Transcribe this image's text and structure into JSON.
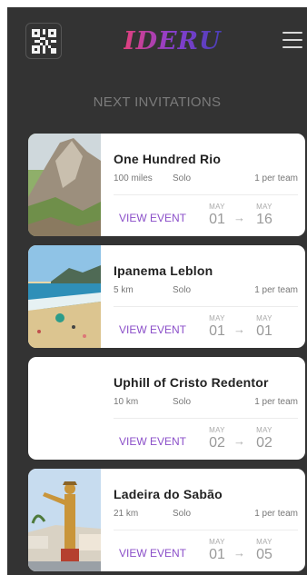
{
  "header": {
    "logo_text": "IDERU",
    "qr_icon": "qr-code-icon",
    "menu_icon": "hamburger-menu-icon"
  },
  "section": {
    "title": "NEXT INVITATIONS"
  },
  "cards": [
    {
      "title": "One Hundred Rio",
      "distance": "100 miles",
      "mode": "Solo",
      "team": "1 per team",
      "view_label": "VIEW EVENT",
      "start": {
        "month": "MAY",
        "day": "01"
      },
      "end": {
        "month": "MAY",
        "day": "16"
      },
      "arrow": "→"
    },
    {
      "title": "Ipanema Leblon",
      "distance": "5 km",
      "mode": "Solo",
      "team": "1 per team",
      "view_label": "VIEW EVENT",
      "start": {
        "month": "MAY",
        "day": "01"
      },
      "end": {
        "month": "MAY",
        "day": "01"
      },
      "arrow": "→"
    },
    {
      "title": "Uphill of Cristo Redentor",
      "distance": "10 km",
      "mode": "Solo",
      "team": "1 per team",
      "view_label": "VIEW EVENT",
      "start": {
        "month": "MAY",
        "day": "02"
      },
      "end": {
        "month": "MAY",
        "day": "02"
      },
      "arrow": "→"
    },
    {
      "title": "Ladeira do Sabão",
      "distance": "21 km",
      "mode": "Solo",
      "team": "1 per team",
      "view_label": "VIEW EVENT",
      "start": {
        "month": "MAY",
        "day": "01"
      },
      "end": {
        "month": "MAY",
        "day": "05"
      },
      "arrow": "→"
    }
  ],
  "colors": {
    "background": "#333333",
    "accent": "#8b4fc9",
    "logo_start": "#e2407c",
    "logo_end": "#4a3fb8"
  }
}
